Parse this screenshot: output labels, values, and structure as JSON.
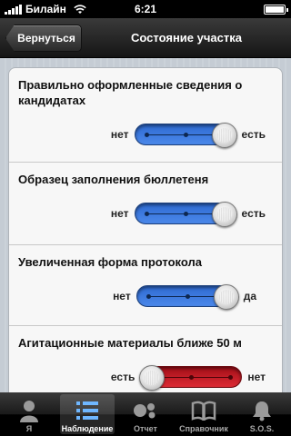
{
  "status_bar": {
    "carrier": "Билайн",
    "time": "6:21"
  },
  "nav": {
    "back_label": "Вернуться",
    "title": "Состояние участка"
  },
  "items": [
    {
      "title": "Правильно оформленные сведения о кандидатах",
      "left": "нет",
      "right": "есть",
      "value": "есть",
      "color": "#3673dc"
    },
    {
      "title": "Образец заполнения бюллетеня",
      "left": "нет",
      "right": "есть",
      "value": "есть",
      "color": "#3673dc"
    },
    {
      "title": "Увеличенная форма протокола",
      "left": "нет",
      "right": "да",
      "value": "да",
      "color": "#3673dc"
    },
    {
      "title": "Агитационные материалы ближе 50 м",
      "left": "есть",
      "right": "нет",
      "value": "есть",
      "color": "#c91c25"
    }
  ],
  "tabs": [
    {
      "label": "Я",
      "icon": "person-icon",
      "active": false
    },
    {
      "label": "Наблюдение",
      "icon": "list-icon",
      "active": true
    },
    {
      "label": "Отчет",
      "icon": "report-icon",
      "active": false
    },
    {
      "label": "Справочник",
      "icon": "book-icon",
      "active": false
    },
    {
      "label": "S.O.S.",
      "icon": "bell-icon",
      "active": false
    }
  ]
}
